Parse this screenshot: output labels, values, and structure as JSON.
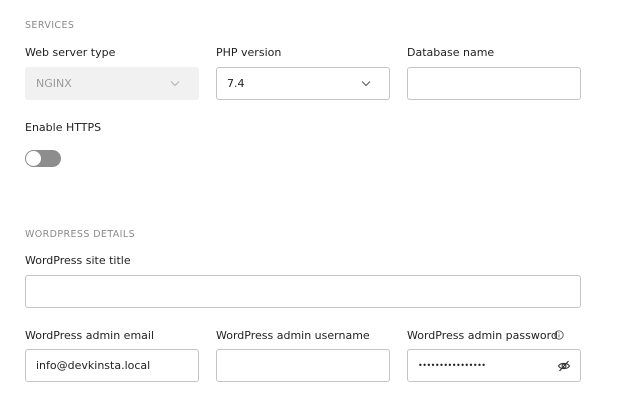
{
  "services": {
    "title": "SERVICES",
    "web_server": {
      "label": "Web server type",
      "value": "NGINX"
    },
    "php": {
      "label": "PHP version",
      "value": "7.4"
    },
    "database": {
      "label": "Database name",
      "value": ""
    },
    "https": {
      "label": "Enable HTTPS",
      "enabled": false
    }
  },
  "wordpress": {
    "title": "WORDPRESS DETAILS",
    "site_title": {
      "label": "WordPress site title",
      "value": ""
    },
    "admin_email": {
      "label": "WordPress admin email",
      "value": "info@devkinsta.local"
    },
    "admin_username": {
      "label": "WordPress admin username",
      "value": ""
    },
    "admin_password": {
      "label": "WordPress admin password",
      "masked": "••••••••••••••••"
    }
  },
  "icons": {
    "dropdown": "chevron-down-icon",
    "info": "info-icon",
    "visibility": "eye-off-icon"
  },
  "colors": {
    "toggle_off": "#8d8d8d",
    "disabled_field": "#f1f1f2",
    "border": "#c4c4c4",
    "section_title": "#8a8a8a"
  }
}
